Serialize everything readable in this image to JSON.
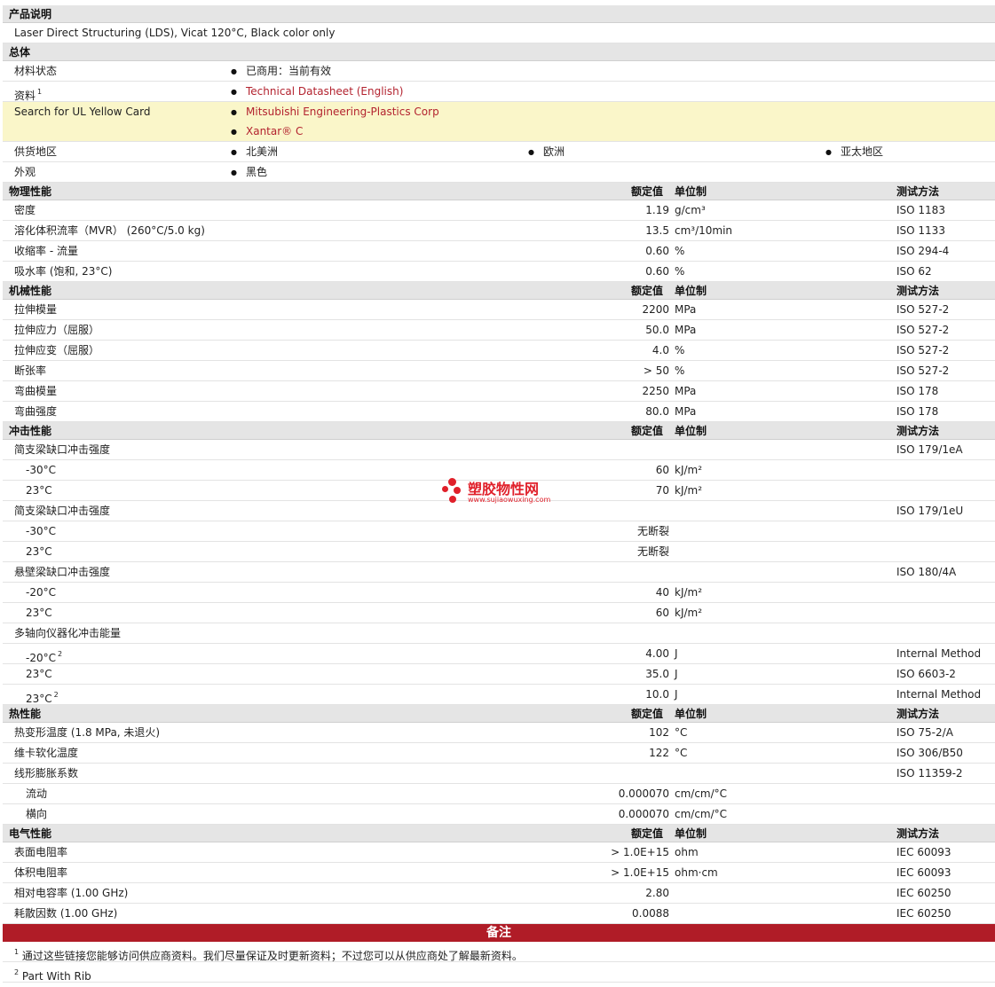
{
  "sections": {
    "desc": "产品说明",
    "general": "总体",
    "physical": "物理性能",
    "mechanical": "机械性能",
    "impact": "冲击性能",
    "thermal": "热性能",
    "electrical": "电气性能",
    "notes": "备注"
  },
  "headers": {
    "value": "额定值",
    "unit": "单位制",
    "test": "测试方法"
  },
  "description": "Laser Direct Structuring (LDS), Vicat 120°C, Black color only",
  "general": {
    "status_label": "材料状态",
    "status_value": "已商用：当前有效",
    "docs_label": "资料",
    "docs_sup": "1",
    "docs_link": "Technical Datasheet (English)",
    "ul_label": "Search for UL Yellow Card",
    "ul_link1": "Mitsubishi Engineering-Plastics Corp",
    "ul_link2": "Xantar® C",
    "region_label": "供货地区",
    "region1": "北美洲",
    "region2": "欧洲",
    "region3": "亚太地区",
    "appearance_label": "外观",
    "appearance_value": "黑色"
  },
  "physical": [
    {
      "label": "密度",
      "value": "1.19",
      "unit": "g/cm³",
      "test": "ISO 1183"
    },
    {
      "label": "溶化体积流率（MVR） (260°C/5.0 kg)",
      "value": "13.5",
      "unit": "cm³/10min",
      "test": "ISO 1133"
    },
    {
      "label": "收缩率  - 流量",
      "value": "0.60",
      "unit": "%",
      "test": "ISO 294-4"
    },
    {
      "label": "吸水率 (饱和, 23°C)",
      "value": "0.60",
      "unit": "%",
      "test": "ISO 62"
    }
  ],
  "mechanical": [
    {
      "label": "拉伸模量",
      "value": "2200",
      "unit": "MPa",
      "test": "ISO 527-2"
    },
    {
      "label": "拉伸应力（屈服）",
      "value": "50.0",
      "unit": "MPa",
      "test": "ISO 527-2"
    },
    {
      "label": "拉伸应变（屈服）",
      "value": "4.0",
      "unit": "%",
      "test": "ISO 527-2"
    },
    {
      "label": "断张率",
      "value": "> 50",
      "unit": "%",
      "test": "ISO 527-2"
    },
    {
      "label": "弯曲模量",
      "value": "2250",
      "unit": "MPa",
      "test": "ISO 178"
    },
    {
      "label": "弯曲强度",
      "value": "80.0",
      "unit": "MPa",
      "test": "ISO 178"
    }
  ],
  "impact": {
    "charpy_notched": {
      "label": "简支梁缺口冲击强度",
      "test": "ISO 179/1eA",
      "rows": [
        {
          "label": "-30°C",
          "value": "60",
          "unit": "kJ/m²"
        },
        {
          "label": "23°C",
          "value": "70",
          "unit": "kJ/m²"
        }
      ]
    },
    "charpy_unnotched": {
      "label": "简支梁缺口冲击强度",
      "test": "ISO 179/1eU",
      "rows": [
        {
          "label": "-30°C",
          "value": "无断裂",
          "unit": ""
        },
        {
          "label": "23°C",
          "value": "无断裂",
          "unit": ""
        }
      ]
    },
    "izod": {
      "label": "悬壁梁缺口冲击强度",
      "test": "ISO 180/4A",
      "rows": [
        {
          "label": "-20°C",
          "value": "40",
          "unit": "kJ/m²"
        },
        {
          "label": "23°C",
          "value": "60",
          "unit": "kJ/m²"
        }
      ]
    },
    "multiaxial": {
      "label": "多轴向仪器化冲击能量",
      "rows": [
        {
          "label": "-20°C",
          "sup": "2",
          "value": "4.00",
          "unit": "J",
          "test": "Internal Method"
        },
        {
          "label": "23°C",
          "sup": "",
          "value": "35.0",
          "unit": "J",
          "test": "ISO 6603-2"
        },
        {
          "label": "23°C",
          "sup": "2",
          "value": "10.0",
          "unit": "J",
          "test": "Internal Method"
        }
      ]
    }
  },
  "thermal": {
    "hdt": {
      "label": "热变形温度 (1.8 MPa, 未退火)",
      "value": "102",
      "unit": "°C",
      "test": "ISO 75-2/A"
    },
    "vicat": {
      "label": "维卡软化温度",
      "value": "122",
      "unit": "°C",
      "test": "ISO 306/B50"
    },
    "clte": {
      "label": "线形膨胀系数",
      "test": "ISO 11359-2",
      "rows": [
        {
          "label": "流动",
          "value": "0.000070",
          "unit": "cm/cm/°C"
        },
        {
          "label": "横向",
          "value": "0.000070",
          "unit": "cm/cm/°C"
        }
      ]
    }
  },
  "electrical": [
    {
      "label": "表面电阻率",
      "value": "> 1.0E+15",
      "unit": "ohm",
      "test": "IEC 60093"
    },
    {
      "label": "体积电阻率",
      "value": "> 1.0E+15",
      "unit": "ohm·cm",
      "test": "IEC 60093"
    },
    {
      "label": "相对电容率 (1.00 GHz)",
      "value": "2.80",
      "unit": "",
      "test": "IEC 60250"
    },
    {
      "label": "耗散因数 (1.00 GHz)",
      "value": "0.0088",
      "unit": "",
      "test": "IEC 60250"
    }
  ],
  "notes": [
    {
      "sup": "1",
      "text": "通过这些链接您能够访问供应商资料。我们尽量保证及时更新资料；不过您可以从供应商处了解最新资料。"
    },
    {
      "sup": "2",
      "text": "Part With Rib"
    }
  ],
  "watermark": {
    "text": "塑胶物性网",
    "url": "www.sujiaowuxing.com"
  },
  "colors": {
    "link": "#b3232f",
    "section_bg": "#e5e5e5",
    "notes_bar": "#b01c27",
    "highlight": "#faf6c9"
  }
}
